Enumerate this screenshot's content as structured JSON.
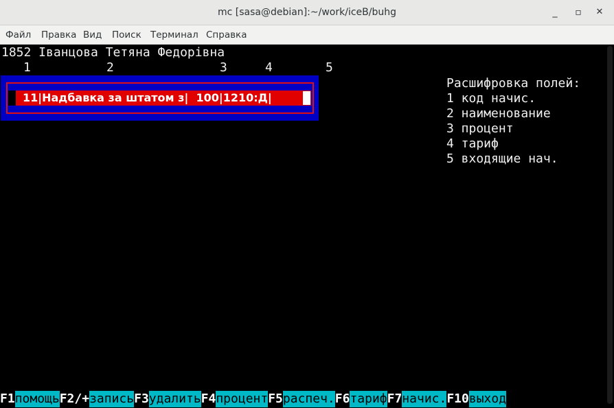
{
  "window": {
    "title": "mc [sasa@debian]:~/work/iceB/buhg",
    "minimize_glyph": "_",
    "maximize_glyph": "▫",
    "close_glyph": "✕"
  },
  "menu": {
    "items": [
      "Файл",
      "Правка",
      "Вид",
      "Поиск",
      "Терминал",
      "Справка"
    ]
  },
  "terminal": {
    "employee_line": "1852 Іванцова Тетяна Федорівна",
    "column_numbers": [
      "1",
      "2",
      "3",
      "4",
      "5"
    ],
    "record": {
      "text": "11|Надбавка за штатом з|  100|1210:Д|"
    },
    "legend": {
      "title": "Расшифровка полей:",
      "items": [
        "1 код начис.",
        "2 наименование",
        "3 процент",
        "4 тариф",
        "5 входящие нач."
      ]
    }
  },
  "function_keys": [
    {
      "key": "F1",
      "label": "помощь"
    },
    {
      "key": "F2/+",
      "label": "запись"
    },
    {
      "key": "F3",
      "label": "удалить"
    },
    {
      "key": "F4",
      "label": "процент"
    },
    {
      "key": "F5",
      "label": "распеч."
    },
    {
      "key": "F6",
      "label": "тариф"
    },
    {
      "key": "F7",
      "label": "начис."
    },
    {
      "key": "F10",
      "label": "выход"
    }
  ],
  "colors": {
    "panel_blue": "#0000c4",
    "record_red": "#e00000",
    "fkey_cyan": "#00b8c6"
  }
}
